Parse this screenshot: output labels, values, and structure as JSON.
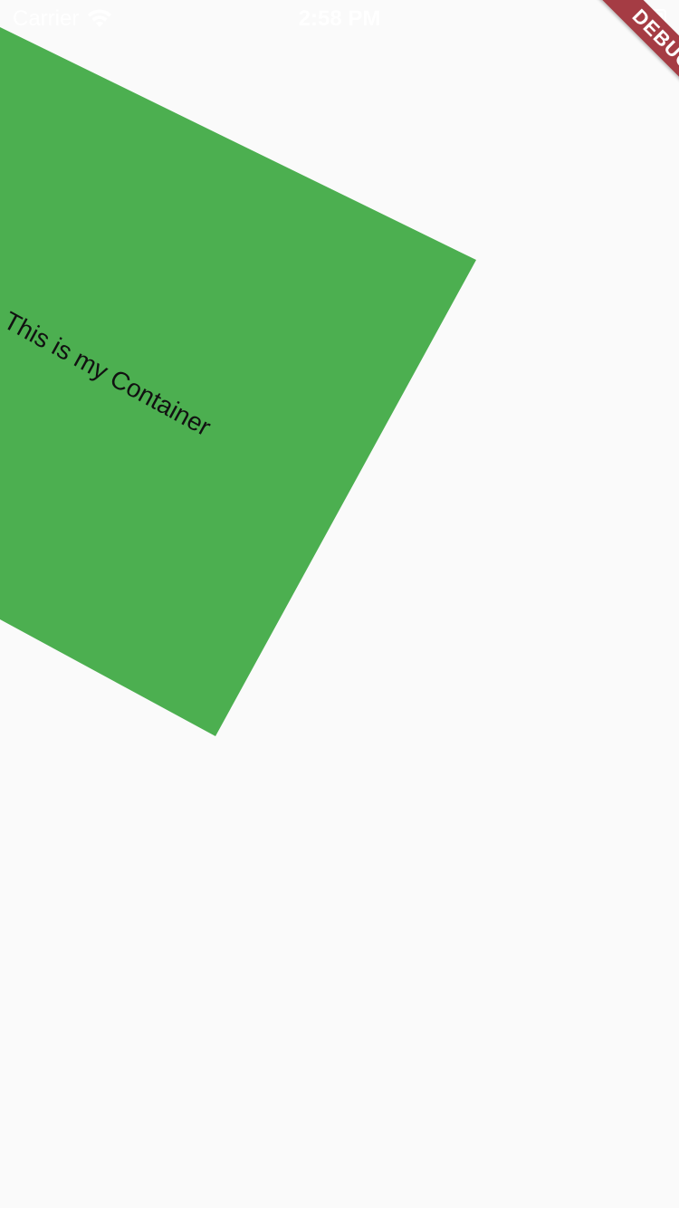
{
  "status_bar": {
    "carrier": "Carrier",
    "time": "2:58 PM",
    "wifi_icon": "wifi-icon",
    "battery_icon": "battery-icon"
  },
  "debug_banner": {
    "label": "DEBUG",
    "color": "#a53c44"
  },
  "container": {
    "text": "This is my Container",
    "color": "#4caf50"
  }
}
